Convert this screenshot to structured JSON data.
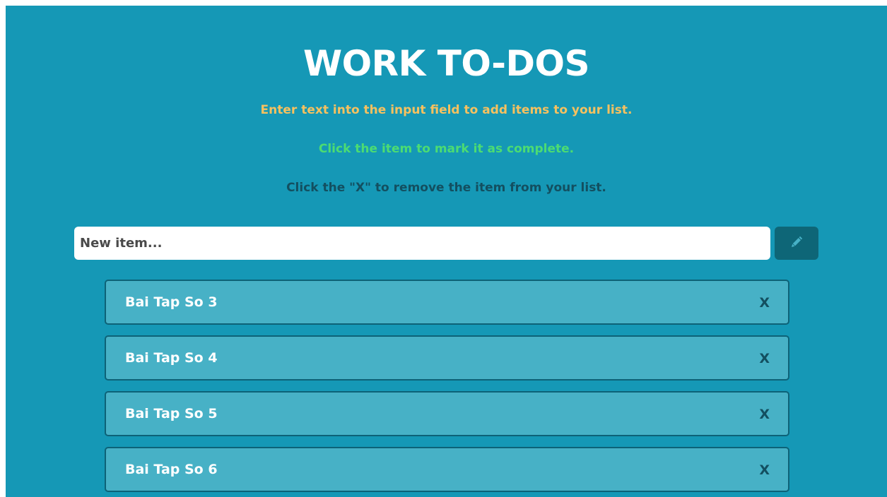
{
  "header": {
    "title": "WORK TO-DOS"
  },
  "instructions": {
    "add": "Enter text into the input field to add items to your list.",
    "complete": "Click the item to mark it as complete.",
    "remove": "Click the \"X\" to remove the item from your list."
  },
  "new_item": {
    "placeholder": "New item...",
    "value": "",
    "button_icon": "pencil-icon"
  },
  "todos": [
    {
      "label": "Bai Tap So 3",
      "remove_label": "X"
    },
    {
      "label": "Bai Tap So 4",
      "remove_label": "X"
    },
    {
      "label": "Bai Tap So 5",
      "remove_label": "X"
    },
    {
      "label": "Bai Tap So 6",
      "remove_label": "X"
    }
  ],
  "colors": {
    "background": "#1598b6",
    "add_instruction": "#f7c15f",
    "complete_instruction": "#4cdc72",
    "remove_instruction": "#134f60",
    "item_background": "#47b1c6",
    "item_border": "#0d6277",
    "button_background": "#0e6677"
  }
}
